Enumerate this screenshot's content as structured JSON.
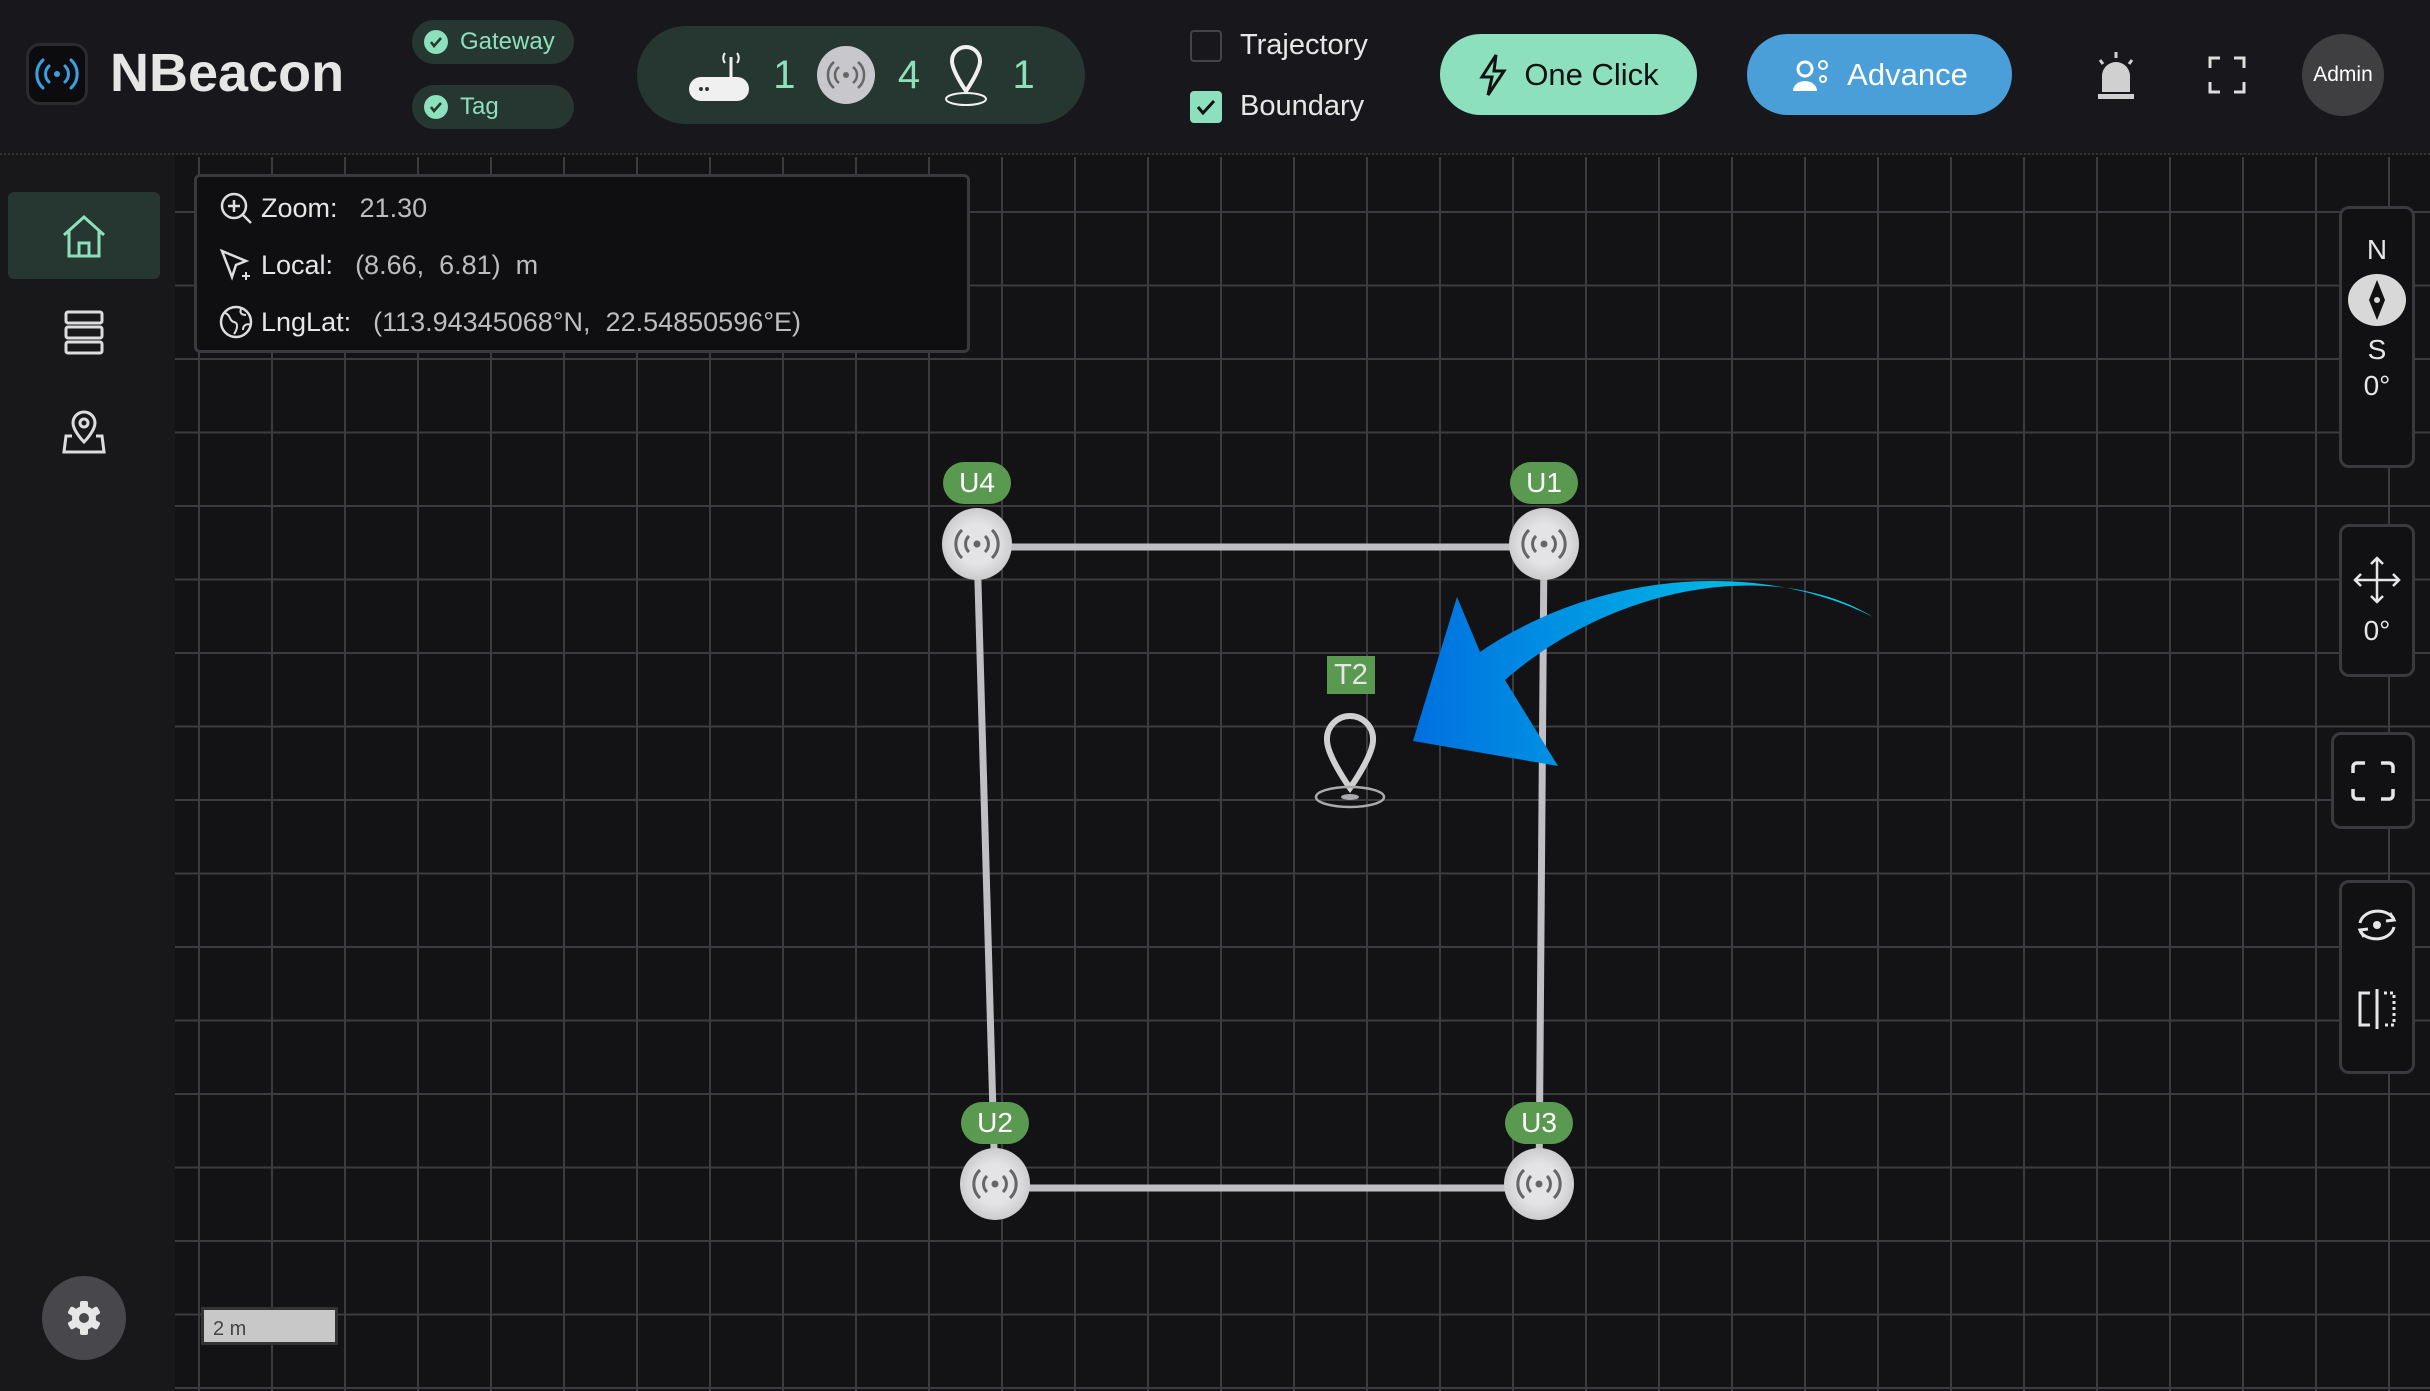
{
  "header": {
    "app_title": "NBeacon",
    "filters": [
      {
        "label": "Gateway",
        "checked": true
      },
      {
        "label": "Tag",
        "checked": true
      }
    ],
    "stats": {
      "gateways": "1",
      "anchors": "4",
      "tags": "1"
    },
    "layers": [
      {
        "label": "Trajectory",
        "checked": false
      },
      {
        "label": "Boundary",
        "checked": true
      }
    ],
    "one_click_label": "One Click",
    "advance_label": "Advance",
    "user": "Admin",
    "colors": {
      "accent_green": "#8ce0bd",
      "accent_blue": "#4a9fd8",
      "label_green": "#5a9a50"
    }
  },
  "sidebar": {
    "items": [
      {
        "icon": "home-icon",
        "active": true
      },
      {
        "icon": "list-icon",
        "active": false
      },
      {
        "icon": "map-pin-icon",
        "active": false
      }
    ],
    "settings_icon": "gear-icon"
  },
  "info": {
    "zoom_label": "Zoom:",
    "zoom_value": "21.30",
    "local_label": "Local:",
    "local_value": "(8.66,  6.81)  m",
    "lnglat_label": "LngLat:",
    "lnglat_value": "(113.94345068°N,  22.54850596°E)"
  },
  "map": {
    "anchors": [
      {
        "id": "U4"
      },
      {
        "id": "U1"
      },
      {
        "id": "U2"
      },
      {
        "id": "U3"
      }
    ],
    "tag": {
      "id": "T2"
    },
    "scale_label": "2 m"
  },
  "toolbar": {
    "north": "N",
    "south": "S",
    "compass_angle": "0°",
    "move_angle": "0°"
  }
}
